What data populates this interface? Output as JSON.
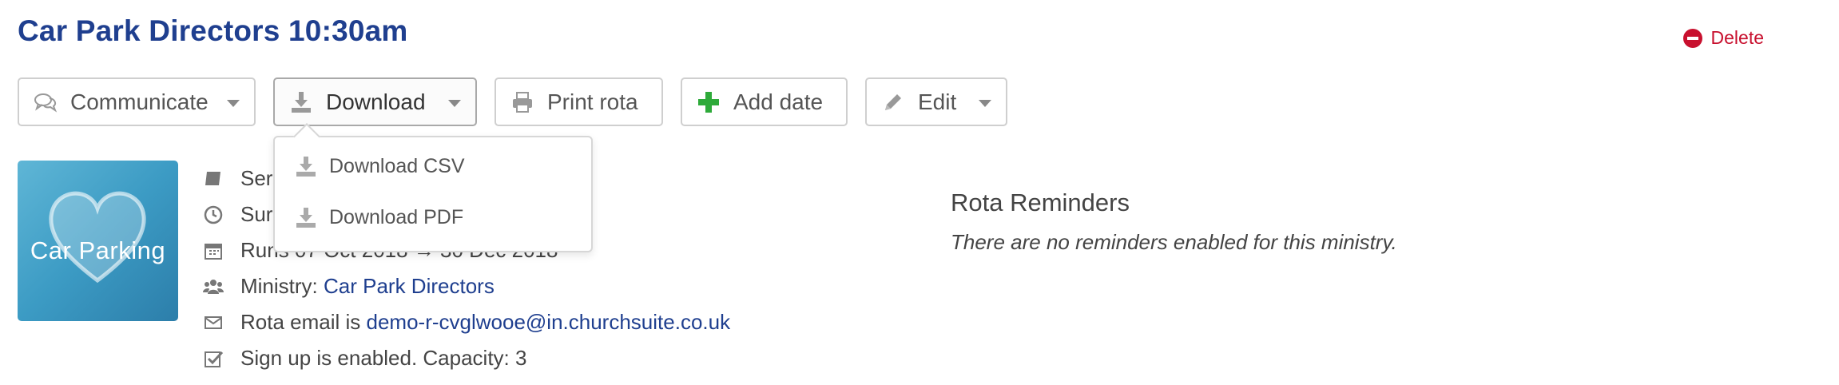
{
  "page": {
    "title": "Car Park Directors 10:30am",
    "delete_label": "Delete"
  },
  "toolbar": {
    "communicate": "Communicate",
    "download": "Download",
    "print": "Print rota",
    "add_date": "Add date",
    "edit": "Edit"
  },
  "download_menu": {
    "csv": "Download CSV",
    "pdf": "Download PDF"
  },
  "thumbnail": {
    "label": "Car Parking"
  },
  "details": {
    "service": "Ser",
    "time": "Sur",
    "runs": "Runs 07 Oct 2018 → 30 Dec 2018",
    "ministry_prefix": "Ministry: ",
    "ministry_link": "Car Park Directors",
    "email_prefix": "Rota email is ",
    "email_link": "demo-r-cvglwooe@in.churchsuite.co.uk",
    "signup": "Sign up is enabled. Capacity: 3"
  },
  "reminders": {
    "heading": "Rota Reminders",
    "empty_text": "There are no reminders enabled for this ministry."
  },
  "colors": {
    "title_blue": "#1f3f8f",
    "delete_red": "#c8102e",
    "add_green": "#2eaa3a",
    "link_blue": "#1f3f8f"
  }
}
